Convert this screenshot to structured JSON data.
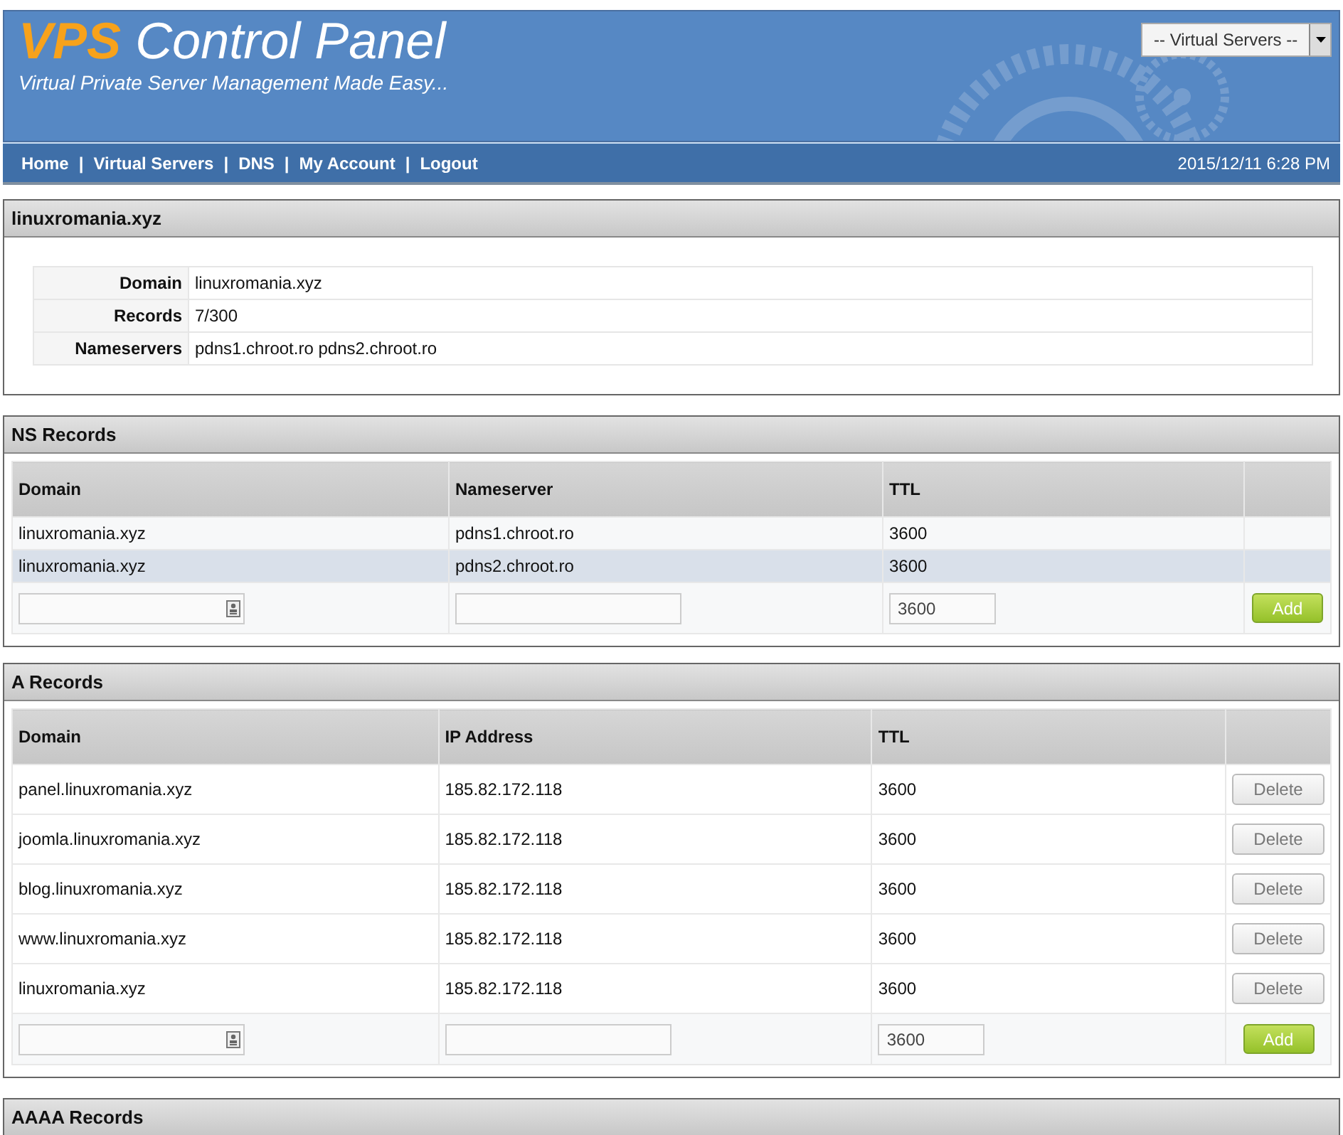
{
  "header": {
    "logo_accent": "VPS",
    "logo_rest": "Control Panel",
    "tagline": "Virtual Private Server Management Made Easy...",
    "server_select": {
      "value": "-- Virtual Servers --"
    }
  },
  "nav": {
    "links": [
      "Home",
      "Virtual Servers",
      "DNS",
      "My Account",
      "Logout"
    ],
    "separator": "|",
    "datetime": "2015/12/11 6:28 PM"
  },
  "domain_panel": {
    "title": "linuxromania.xyz",
    "rows": [
      {
        "label": "Domain",
        "value": "linuxromania.xyz"
      },
      {
        "label": "Records",
        "value": "7/300"
      },
      {
        "label": "Nameservers",
        "value": "pdns1.chroot.ro pdns2.chroot.ro"
      }
    ]
  },
  "ns_records": {
    "title": "NS Records",
    "columns": [
      "Domain",
      "Nameserver",
      "TTL"
    ],
    "rows": [
      {
        "cells": [
          "linuxromania.xyz",
          "pdns1.chroot.ro",
          "3600"
        ],
        "selected": false
      },
      {
        "cells": [
          "linuxromania.xyz",
          "pdns2.chroot.ro",
          "3600"
        ],
        "selected": true
      }
    ],
    "new_row": {
      "ttl_value": "3600",
      "button": "Add"
    }
  },
  "a_records": {
    "title": "A Records",
    "columns": [
      "Domain",
      "IP Address",
      "TTL"
    ],
    "rows": [
      {
        "cells": [
          "panel.linuxromania.xyz",
          "185.82.172.118",
          "3600"
        ],
        "button": "Delete"
      },
      {
        "cells": [
          "joomla.linuxromania.xyz",
          "185.82.172.118",
          "3600"
        ],
        "button": "Delete"
      },
      {
        "cells": [
          "blog.linuxromania.xyz",
          "185.82.172.118",
          "3600"
        ],
        "button": "Delete"
      },
      {
        "cells": [
          "www.linuxromania.xyz",
          "185.82.172.118",
          "3600"
        ],
        "button": "Delete"
      },
      {
        "cells": [
          "linuxromania.xyz",
          "185.82.172.118",
          "3600"
        ],
        "button": "Delete"
      }
    ],
    "new_row": {
      "ttl_value": "3600",
      "button": "Add"
    }
  },
  "aaaa_records": {
    "title": "AAAA Records"
  }
}
